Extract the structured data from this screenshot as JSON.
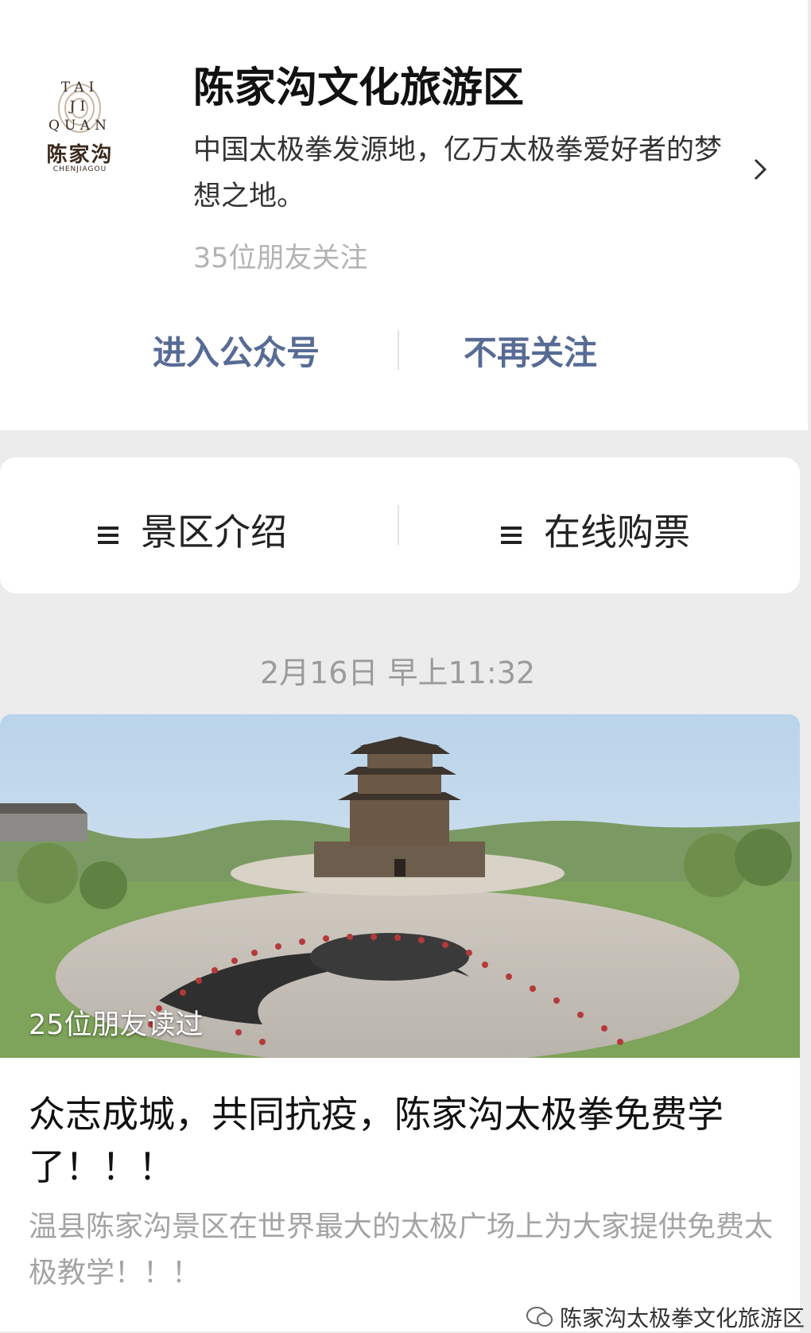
{
  "profile": {
    "logo": {
      "line1": "TAI",
      "line2": "JI",
      "line3": "QUAN",
      "name_cn": "陈家沟",
      "name_en": "CHENJIAGOU"
    },
    "name": "陈家沟文化旅游区",
    "description": "中国太极拳发源地，亿万太极拳爱好者的梦想之地。",
    "followers": "35位朋友关注",
    "actions": {
      "enter": "进入公众号",
      "unfollow": "不再关注"
    }
  },
  "menu": {
    "items": [
      {
        "label": "景区介绍",
        "icon": "menu-icon"
      },
      {
        "label": "在线购票",
        "icon": "menu-icon"
      }
    ]
  },
  "timestamp": "2月16日 早上11:32",
  "article": {
    "read_badge": "25位朋友读过",
    "title": "众志成城，共同抗疫，陈家沟太极拳免费学了！！！",
    "summary": "温县陈家沟景区在世界最大的太极广场上为大家提供免费太极教学！！！"
  },
  "watermark": "陈家沟太极拳文化旅游区",
  "colors": {
    "link": "#576b95",
    "background": "#ececec",
    "muted": "#9b9b9b"
  }
}
